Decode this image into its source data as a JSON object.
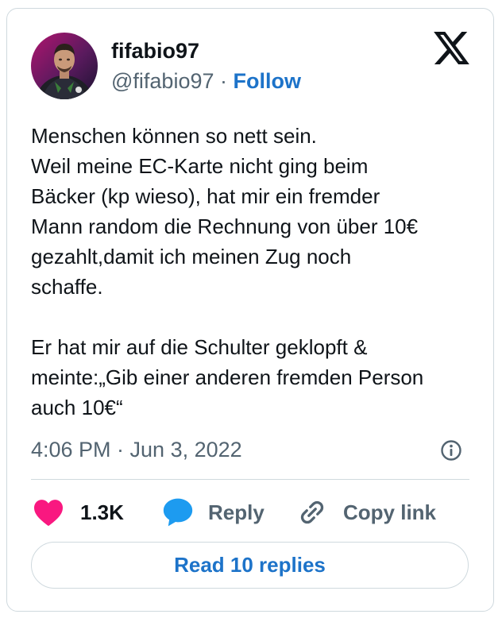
{
  "author": {
    "display_name": "fifabio97",
    "handle": "@fifabio97",
    "separator": "·",
    "follow_label": "Follow"
  },
  "tweet": {
    "text": "Menschen können so nett sein.\nWeil meine EC-Karte nicht ging beim\nBäcker (kp wieso), hat mir ein fremder\nMann random die Rechnung von über 10€\ngezahlt,damit ich meinen Zug noch\nschaffe.\n\nEr hat mir auf die Schulter geklopft &\nmeinte:„Gib einer anderen fremden Person\nauch 10€“",
    "timestamp": "4:06 PM · Jun 3, 2022"
  },
  "actions": {
    "like_count": "1.3K",
    "reply_label": "Reply",
    "copy_link_label": "Copy link"
  },
  "read_replies_label": "Read 10 replies",
  "icons": {
    "brand_logo": "x-logo-icon",
    "like": "heart-icon",
    "reply": "speech-bubble-icon",
    "copy_link": "link-icon",
    "info": "info-icon"
  },
  "colors": {
    "heart": "#f91880",
    "reply_bubble": "#1d9bf0",
    "link": "#1d73c9",
    "secondary_text": "#536471",
    "border": "#cfd9de"
  }
}
